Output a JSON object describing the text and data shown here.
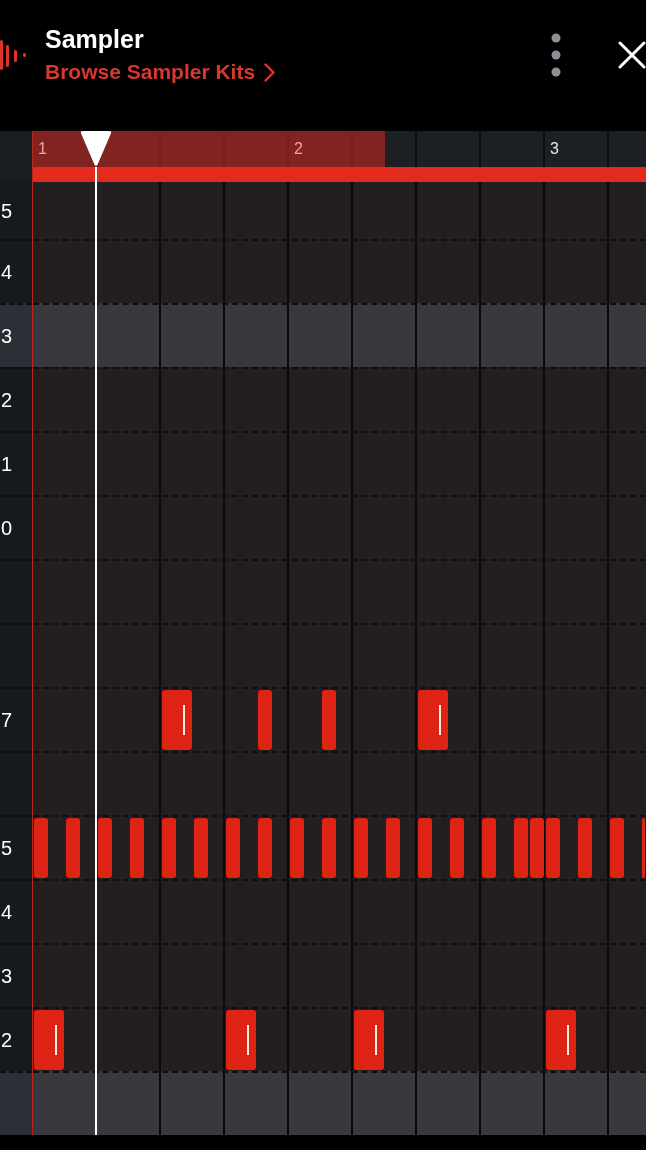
{
  "header": {
    "title": "Sampler",
    "link": "Browse Sampler Kits"
  },
  "ruler": {
    "bars": [
      {
        "label": "1"
      },
      {
        "label": "2"
      },
      {
        "label": "3"
      }
    ],
    "loop_region": {
      "level": 0.574
    },
    "playhead": {
      "level": 0.103
    }
  },
  "rows": [
    {
      "label": "5",
      "highlighted": false
    },
    {
      "label": "4",
      "highlighted": false
    },
    {
      "label": "3",
      "highlighted": true
    },
    {
      "label": "2",
      "highlighted": false
    },
    {
      "label": "1",
      "highlighted": false
    },
    {
      "label": "0",
      "highlighted": false
    },
    {
      "highlighted": false
    },
    {
      "highlighted": false
    },
    {
      "label": "7",
      "highlighted": false,
      "steps": [
        {
          "kind": "rest"
        },
        {
          "kind": "rest"
        },
        {
          "kind": "rest"
        },
        {
          "kind": "rest"
        },
        {
          "kind": "rest"
        },
        {
          "kind": "rest"
        },
        {
          "kind": "rest"
        },
        {
          "kind": "rest"
        },
        {
          "kind": "long"
        },
        {
          "kind": "rest"
        },
        {
          "kind": "rest"
        },
        {
          "kind": "rest"
        },
        {
          "kind": "rest"
        },
        {
          "kind": "short"
        },
        {
          "kind": "rest"
        },
        {
          "kind": "rest"
        },
        {
          "kind": "rest"
        },
        {
          "kind": "short"
        },
        {
          "kind": "rest"
        },
        {
          "kind": "rest"
        },
        {
          "kind": "rest"
        },
        {
          "kind": "rest"
        },
        {
          "kind": "rest"
        },
        {
          "kind": "long"
        }
      ]
    },
    {
      "highlighted": false
    },
    {
      "label": "5",
      "highlighted": false,
      "steps": [
        {
          "kind": "short"
        },
        {
          "kind": "rest"
        },
        {
          "kind": "short"
        },
        {
          "kind": "rest"
        },
        {
          "kind": "short"
        },
        {
          "kind": "rest"
        },
        {
          "kind": "short"
        },
        {
          "kind": "rest"
        },
        {
          "kind": "short"
        },
        {
          "kind": "rest"
        },
        {
          "kind": "short"
        },
        {
          "kind": "rest"
        },
        {
          "kind": "short"
        },
        {
          "kind": "rest"
        },
        {
          "kind": "short"
        },
        {
          "kind": "rest"
        },
        {
          "kind": "short"
        },
        {
          "kind": "rest"
        },
        {
          "kind": "short"
        },
        {
          "kind": "rest"
        },
        {
          "kind": "short"
        },
        {
          "kind": "rest"
        },
        {
          "kind": "short"
        },
        {
          "kind": "rest"
        },
        {
          "kind": "short"
        },
        {
          "kind": "rest"
        },
        {
          "kind": "short"
        },
        {
          "kind": "rest"
        },
        {
          "kind": "short"
        },
        {
          "kind": "rest"
        },
        {
          "kind": "short"
        },
        {
          "kind": "short"
        },
        {
          "kind": "short"
        },
        {
          "kind": "rest"
        },
        {
          "kind": "short"
        },
        {
          "kind": "rest"
        },
        {
          "kind": "short"
        },
        {
          "kind": "rest"
        },
        {
          "kind": "short"
        }
      ]
    },
    {
      "label": "4",
      "highlighted": false
    },
    {
      "label": "3",
      "highlighted": false
    },
    {
      "label": "2",
      "highlighted": false,
      "steps": [
        {
          "kind": "long"
        },
        {
          "kind": "rest"
        },
        {
          "kind": "rest"
        },
        {
          "kind": "rest"
        },
        {
          "kind": "rest"
        },
        {
          "kind": "rest"
        },
        {
          "kind": "rest"
        },
        {
          "kind": "rest"
        },
        {
          "kind": "rest"
        },
        {
          "kind": "rest"
        },
        {
          "kind": "rest"
        },
        {
          "kind": "long"
        },
        {
          "kind": "rest"
        },
        {
          "kind": "rest"
        },
        {
          "kind": "rest"
        },
        {
          "kind": "rest"
        },
        {
          "kind": "rest"
        },
        {
          "kind": "rest"
        },
        {
          "kind": "long"
        },
        {
          "kind": "rest"
        },
        {
          "kind": "rest"
        },
        {
          "kind": "rest"
        },
        {
          "kind": "rest"
        },
        {
          "kind": "rest"
        },
        {
          "kind": "rest"
        },
        {
          "kind": "rest"
        },
        {
          "kind": "rest"
        },
        {
          "kind": "rest"
        },
        {
          "kind": "rest"
        },
        {
          "kind": "long"
        }
      ]
    },
    {
      "highlighted": true
    }
  ]
}
